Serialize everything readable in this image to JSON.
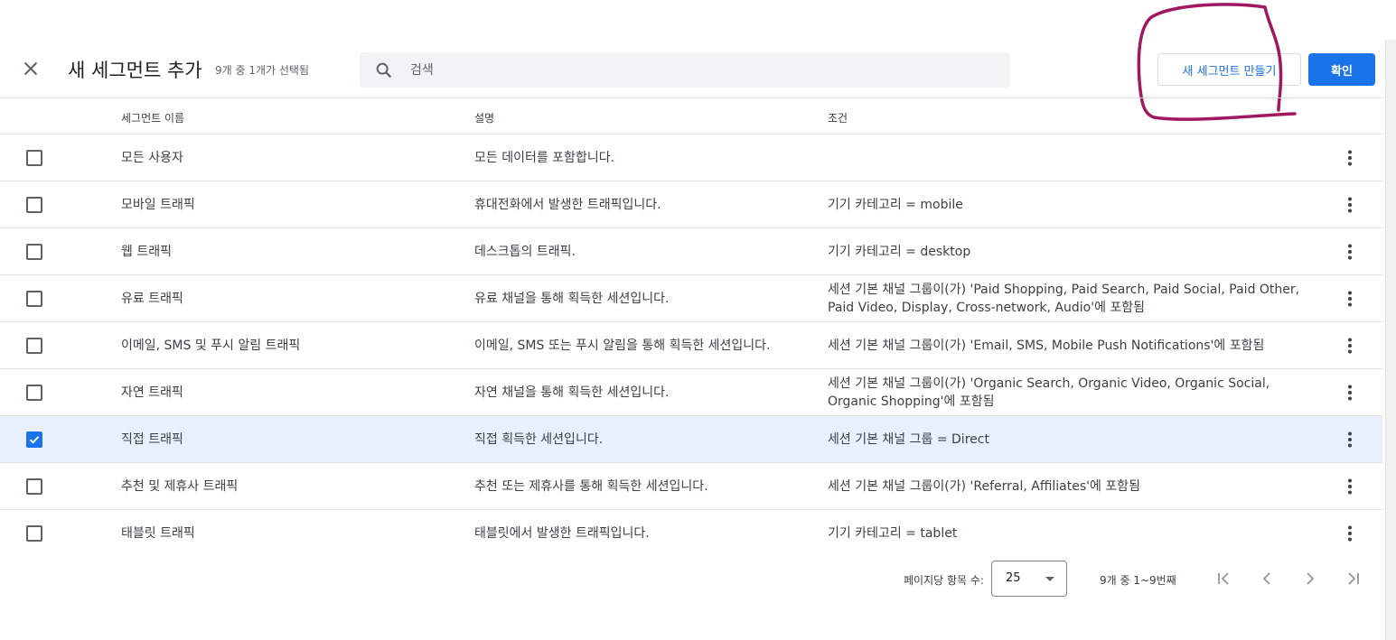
{
  "header": {
    "title": "새 세그먼트 추가",
    "subtitle": "9개 중 1개가 선택됨",
    "search_placeholder": "검색",
    "new_segment_label": "새 세그먼트 만들기",
    "confirm_label": "확인"
  },
  "table": {
    "columns": [
      "세그먼트 이름",
      "설명",
      "조건"
    ],
    "rows": [
      {
        "name": "모든 사용자",
        "description": "모든 데이터를 포함합니다.",
        "condition": "",
        "checked": false
      },
      {
        "name": "모바일 트래픽",
        "description": "휴대전화에서 발생한 트래픽입니다.",
        "condition": "기기 카테고리 = mobile",
        "checked": false
      },
      {
        "name": "웹 트래픽",
        "description": "데스크톱의 트래픽.",
        "condition": "기기 카테고리 = desktop",
        "checked": false
      },
      {
        "name": "유료 트래픽",
        "description": "유료 채널을 통해 획득한 세션입니다.",
        "condition": "세션 기본 채널 그룹이(가) 'Paid Shopping, Paid Search, Paid Social, Paid Other, Paid Video, Display, Cross-network, Audio'에 포함됨",
        "checked": false
      },
      {
        "name": "이메일, SMS 및 푸시 알림 트래픽",
        "description": "이메일, SMS 또는 푸시 알림을 통해 획득한 세션입니다.",
        "condition": "세션 기본 채널 그룹이(가) 'Email, SMS, Mobile Push Notifications'에 포함됨",
        "checked": false
      },
      {
        "name": "자연 트래픽",
        "description": "자연 채널을 통해 획득한 세션입니다.",
        "condition": "세션 기본 채널 그룹이(가) 'Organic Search, Organic Video, Organic Social, Organic Shopping'에 포함됨",
        "checked": false
      },
      {
        "name": "직접 트래픽",
        "description": "직접 획득한 세션입니다.",
        "condition": "세션 기본 채널 그룹 = Direct",
        "checked": true
      },
      {
        "name": "추천 및 제휴사 트래픽",
        "description": "추천 또는 제휴사를 통해 획득한 세션입니다.",
        "condition": "세션 기본 채널 그룹이(가) 'Referral, Affiliates'에 포함됨",
        "checked": false
      },
      {
        "name": "태블릿 트래픽",
        "description": "태블릿에서 발생한 트래픽입니다.",
        "condition": "기기 카테고리 = tablet",
        "checked": false
      }
    ]
  },
  "pagination": {
    "per_page_label": "페이지당 항목 수:",
    "per_page_value": "25",
    "range_text": "9개 중 1~9번째"
  },
  "icons": {
    "close": "close-icon",
    "search": "search-icon",
    "more": "more-vert-icon",
    "first_page": "first-page-icon",
    "prev_page": "chevron-left-icon",
    "next_page": "chevron-right-icon",
    "last_page": "last-page-icon",
    "dropdown": "caret-down-icon"
  },
  "colors": {
    "accent": "#1a73e8",
    "selected_row": "#e8f0fe",
    "annotation": "#a0185f"
  }
}
